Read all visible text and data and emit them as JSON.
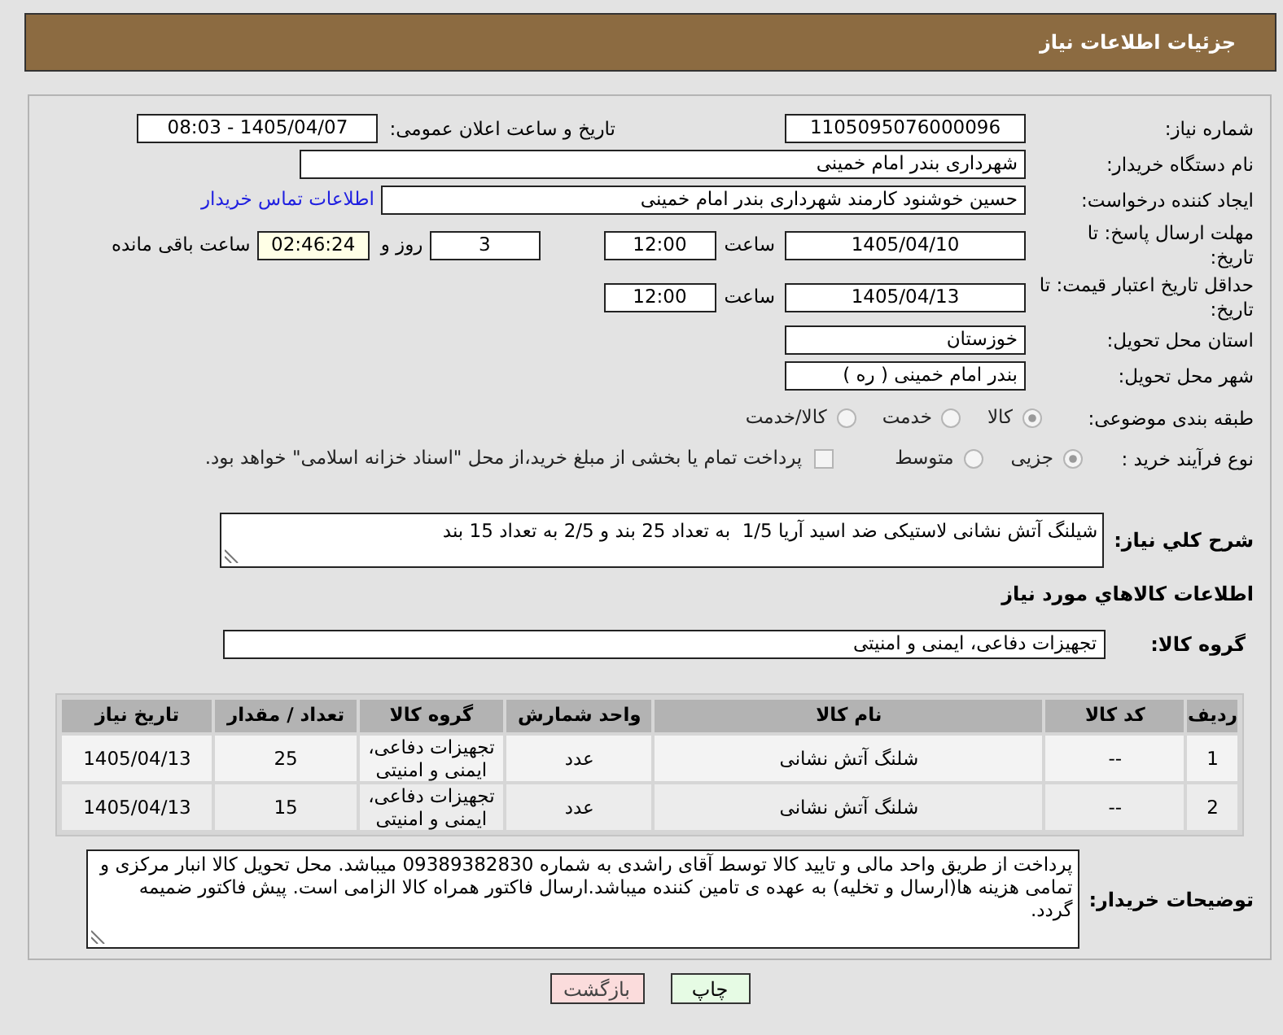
{
  "header": {
    "title": "جزئیات اطلاعات نیاز"
  },
  "need_number": {
    "label": "شماره نیاز:",
    "value": "1105095076000096"
  },
  "announcement": {
    "label": "تاریخ و ساعت اعلان عمومی:",
    "value": "1405/04/07 - 08:03"
  },
  "buyer_organization": {
    "label": "نام دستگاه خریدار:",
    "value": "شهرداری بندر امام خمینی"
  },
  "requester": {
    "label": "ایجاد کننده درخواست:",
    "value": "حسین خوشنود کارمند شهرداری بندر امام خمینی",
    "contact_link": "اطلاعات تماس خریدار"
  },
  "response_deadline": {
    "label": "مهلت ارسال پاسخ: تا تاریخ:",
    "date": "1405/04/10",
    "time_label": "ساعت",
    "time": "12:00",
    "days": "3",
    "days_label": "روز و",
    "remaining": "02:46:24",
    "remaining_label": "ساعت باقی مانده"
  },
  "price_validity": {
    "label": "حداقل تاریخ اعتبار قیمت: تا تاریخ:",
    "date": "1405/04/13",
    "time_label": "ساعت",
    "time": "12:00"
  },
  "delivery_province": {
    "label": "استان محل تحویل:",
    "value": "خوزستان"
  },
  "delivery_city": {
    "label": "شهر محل تحویل:",
    "value": "بندر امام خمینی ( ره )"
  },
  "subject_category": {
    "label": "طبقه بندی موضوعی:",
    "options": [
      {
        "label": "کالا",
        "selected": true
      },
      {
        "label": "خدمت",
        "selected": false
      },
      {
        "label": "کالا/خدمت",
        "selected": false
      }
    ]
  },
  "purchase_process": {
    "label": "نوع فرآیند خرید :",
    "options": [
      {
        "label": "جزیی",
        "selected": true
      },
      {
        "label": "متوسط",
        "selected": false
      }
    ],
    "treasury_payment": {
      "label": "پرداخت تمام یا بخشی از مبلغ خرید،از محل \"اسناد خزانه اسلامی\" خواهد بود.",
      "checked": false
    }
  },
  "description": {
    "label": "شرح کلي نیاز:",
    "value": "شیلنگ آتش نشانی لاستیکی ضد اسید آریا 1/5  به تعداد 25 بند و 2/5 به تعداد 15 بند"
  },
  "goods_section": {
    "title": "اطلاعات کالاهاي مورد نياز",
    "group_label": "گروه کالا:",
    "group_value": "تجهیزات دفاعی، ایمنی و امنیتی"
  },
  "table": {
    "columns": [
      "ردیف",
      "کد کالا",
      "نام کالا",
      "واحد شمارش",
      "گروه کالا",
      "تعداد / مقدار",
      "تاریخ نیاز"
    ],
    "rows": [
      [
        "1",
        "--",
        "شلنگ آتش نشانی",
        "عدد",
        "تجهیزات دفاعی، ایمنی و امنیتی",
        "25",
        "1405/04/13"
      ],
      [
        "2",
        "--",
        "شلنگ آتش نشانی",
        "عدد",
        "تجهیزات دفاعی، ایمنی و امنیتی",
        "15",
        "1405/04/13"
      ]
    ]
  },
  "buyer_notes": {
    "label": "توضیحات خریدار:",
    "value": "پرداخت از طریق واحد مالی و تایید کالا توسط آقای راشدی به شماره 09389382830 میباشد. محل تحویل کالا انبار مرکزی و تمامی هزینه ها(ارسال و تخلیه) به عهده ی تامین کننده میباشد.ارسال فاکتور همراه کالا الزامی است. پیش فاکتور ضمیمه گردد."
  },
  "buttons": [
    {
      "label": "چاپ",
      "kind": "print"
    },
    {
      "label": "بازگشت",
      "kind": "back"
    }
  ]
}
